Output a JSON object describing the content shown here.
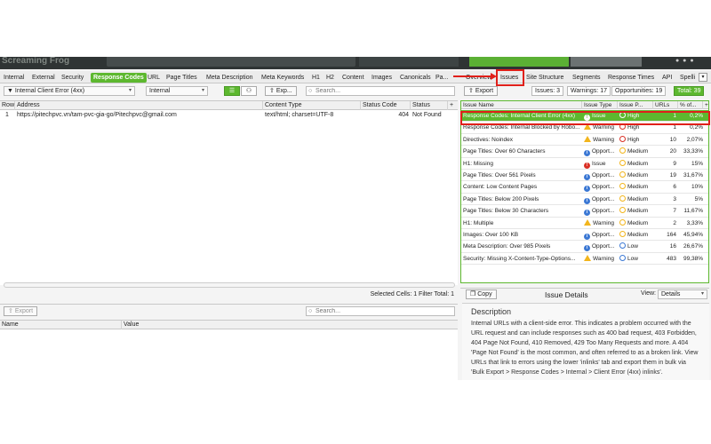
{
  "header": {
    "logo_text": "Screaming Frog"
  },
  "tabs": [
    {
      "label": "Internal"
    },
    {
      "label": "External"
    },
    {
      "label": "Security"
    },
    {
      "label": "Response Codes"
    },
    {
      "label": "URL"
    },
    {
      "label": "Page Titles"
    },
    {
      "label": "Meta Description"
    },
    {
      "label": "Meta Keywords"
    },
    {
      "label": "H1"
    },
    {
      "label": "H2"
    },
    {
      "label": "Content"
    },
    {
      "label": "Images"
    },
    {
      "label": "Canonicals"
    },
    {
      "label": "Pa..."
    },
    {
      "label": "Overview"
    },
    {
      "label": "Issues"
    },
    {
      "label": "Site Structure"
    },
    {
      "label": "Segments"
    },
    {
      "label": "Response Times"
    },
    {
      "label": "API"
    },
    {
      "label": "Spelli"
    }
  ],
  "filter_bar": {
    "filter_select": "Internal Client Error (4xx)",
    "scope_select": "Internal",
    "export_label": "Exp...",
    "search_placeholder": "Search..."
  },
  "grid": {
    "columns": [
      "Row",
      "Address",
      "Content Type",
      "Status Code",
      "Status"
    ],
    "rows": [
      {
        "row": "1",
        "address": "https://pitechpvc.vn/tam-pvc-gia-go/Pitechpvc@gmail.com",
        "content_type": "text/html; charset=UTF-8",
        "status_code": "404",
        "status": "Not Found"
      }
    ],
    "status_line": "Selected Cells: 1  Filter Total: 1"
  },
  "lower_pane": {
    "export_label": "Export",
    "search_placeholder": "Search...",
    "columns": [
      "Name",
      "Value"
    ]
  },
  "issues_panel": {
    "export_label": "Export",
    "badges": {
      "issues": "Issues: 3",
      "warnings": "Warnings: 17",
      "opportunities": "Opportunities: 19",
      "total": "Total: 39"
    },
    "columns": [
      "Issue Name",
      "Issue Type",
      "Issue P...",
      "URLs",
      "% of..."
    ],
    "rows": [
      {
        "name": "Response Codes: Internal Client Error (4xx)",
        "type": "Issue",
        "type_kind": "issue",
        "priority": "High",
        "priority_kind": "high",
        "urls": "1",
        "pct": "0,2%",
        "selected": true
      },
      {
        "name": "Response Codes: Internal Blocked by Robo...",
        "type": "Warning",
        "type_kind": "warn",
        "priority": "High",
        "priority_kind": "high",
        "urls": "1",
        "pct": "0,2%"
      },
      {
        "name": "Directives: Noindex",
        "type": "Warning",
        "type_kind": "warn",
        "priority": "High",
        "priority_kind": "high",
        "urls": "10",
        "pct": "2,07%"
      },
      {
        "name": "Page Titles: Over 60 Characters",
        "type": "Opport...",
        "type_kind": "opp",
        "priority": "Medium",
        "priority_kind": "medium",
        "urls": "20",
        "pct": "33,33%"
      },
      {
        "name": "H1: Missing",
        "type": "Issue",
        "type_kind": "issue",
        "priority": "Medium",
        "priority_kind": "medium",
        "urls": "9",
        "pct": "15%"
      },
      {
        "name": "Page Titles: Over 561 Pixels",
        "type": "Opport...",
        "type_kind": "opp",
        "priority": "Medium",
        "priority_kind": "medium",
        "urls": "19",
        "pct": "31,67%"
      },
      {
        "name": "Content: Low Content Pages",
        "type": "Opport...",
        "type_kind": "opp",
        "priority": "Medium",
        "priority_kind": "medium",
        "urls": "6",
        "pct": "10%"
      },
      {
        "name": "Page Titles: Below 200 Pixels",
        "type": "Opport...",
        "type_kind": "opp",
        "priority": "Medium",
        "priority_kind": "medium",
        "urls": "3",
        "pct": "5%"
      },
      {
        "name": "Page Titles: Below 30 Characters",
        "type": "Opport...",
        "type_kind": "opp",
        "priority": "Medium",
        "priority_kind": "medium",
        "urls": "7",
        "pct": "11,67%"
      },
      {
        "name": "H1: Multiple",
        "type": "Warning",
        "type_kind": "warn",
        "priority": "Medium",
        "priority_kind": "medium",
        "urls": "2",
        "pct": "3,33%"
      },
      {
        "name": "Images: Over 100 KB",
        "type": "Opport...",
        "type_kind": "opp",
        "priority": "Medium",
        "priority_kind": "medium",
        "urls": "164",
        "pct": "45,94%"
      },
      {
        "name": "Meta Description: Over 985 Pixels",
        "type": "Opport...",
        "type_kind": "opp",
        "priority": "Low",
        "priority_kind": "low",
        "urls": "16",
        "pct": "26,67%"
      },
      {
        "name": "Security: Missing X-Content-Type-Options...",
        "type": "Warning",
        "type_kind": "warn",
        "priority": "Low",
        "priority_kind": "low",
        "urls": "483",
        "pct": "99,38%"
      }
    ],
    "details": {
      "copy_label": "Copy",
      "title": "Issue Details",
      "view_label": "View:",
      "view_value": "Details",
      "description_heading": "Description",
      "description_text": "Internal URLs with a client-side error. This indicates a problem occurred with the URL request and can include responses such as 400 bad request, 403 Forbidden, 404 Page Not Found, 410 Removed, 429 Too Many Requests and more. A 404 'Page Not Found' is the most common, and often referred to as a broken link. View URLs that link to errors using the lower 'inlinks' tab and export them in bulk via 'Bulk Export > Response Codes > Internal > Client Error (4xx) inlinks'."
    }
  },
  "colors": {
    "accent_green": "#5db82f",
    "highlight_red": "#e0201a",
    "issue_red": "#d93025",
    "warning_yellow": "#f2b51c",
    "opportunity_blue": "#3b78d4"
  }
}
